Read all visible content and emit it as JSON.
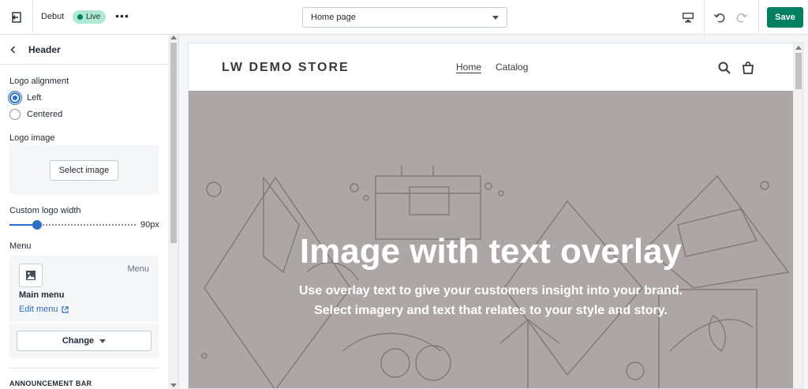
{
  "topbar": {
    "theme_name": "Debut",
    "live_label": "Live",
    "more_label": "•••",
    "page_select": "Home page",
    "save_label": "Save"
  },
  "sidebar": {
    "title": "Header",
    "logo_alignment": {
      "label": "Logo alignment",
      "options": [
        {
          "label": "Left",
          "checked": true
        },
        {
          "label": "Centered",
          "checked": false
        }
      ]
    },
    "logo_image": {
      "label": "Logo image",
      "button": "Select image"
    },
    "logo_width": {
      "label": "Custom logo width",
      "value": "90px",
      "slider_fraction": 0.22
    },
    "menu": {
      "label": "Menu",
      "tag": "Menu",
      "name": "Main menu",
      "edit_link": "Edit menu",
      "change_button": "Change"
    },
    "next_section": "ANNOUNCEMENT BAR"
  },
  "preview": {
    "store_name": "LW DEMO STORE",
    "nav": [
      {
        "label": "Home",
        "active": true
      },
      {
        "label": "Catalog",
        "active": false
      }
    ],
    "hero": {
      "title": "Image with text overlay",
      "text": "Use overlay text to give your customers insight into your brand. Select imagery and text that relates to your style and story."
    }
  },
  "colors": {
    "accent": "#008060",
    "link": "#2c6ecb",
    "hero_bg": "#ada6a6"
  }
}
